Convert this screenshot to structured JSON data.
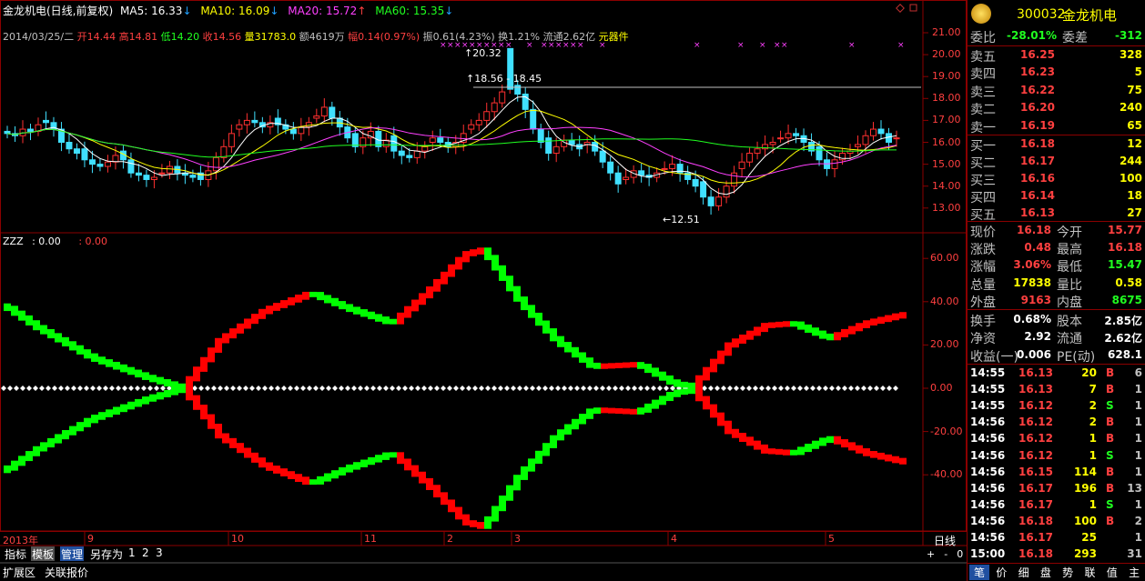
{
  "header": {
    "title": "金龙机电(日线,前复权)",
    "ma5": "MA5: 16.33",
    "ma10": "MA10: 16.09",
    "ma20": "MA20: 15.72",
    "ma60": "MA60: 15.35",
    "date": "2014/03/25/二",
    "open": "开14.44",
    "high": "高14.81",
    "low": "低14.20",
    "close": "收14.56",
    "vol": "量31783.0",
    "amount": "额4619万",
    "change": "幅0.14(0.97%)",
    "amp": "振0.61(4.23%)",
    "turnover": "换1.21%",
    "float": "流通2.62亿",
    "sector": "元器件"
  },
  "price_axis": [
    "21.00",
    "20.00",
    "19.00",
    "18.00",
    "17.00",
    "16.00",
    "15.00",
    "14.00",
    "13.00"
  ],
  "annotations": {
    "high": "20.32",
    "range": "18.56 - 18.45",
    "low": "12.51"
  },
  "indicator": {
    "name": "ZZZ",
    "v1": ": 0.00",
    "v2": ": 0.00",
    "axis": [
      "60.00",
      "40.00",
      "20.00",
      "0.00",
      "-20.00",
      "-40.00"
    ]
  },
  "time_axis": {
    "labels": [
      "2013年",
      "9",
      "10",
      "11",
      "2",
      "3",
      "4",
      "5"
    ],
    "period": "日线"
  },
  "toolbar": {
    "items": [
      "指标",
      "模板",
      "管理",
      "另存为",
      "1",
      "2",
      "3"
    ],
    "zoom": [
      "+",
      "-",
      "0"
    ]
  },
  "bottom_tabs": [
    "扩展区",
    "关联报价"
  ],
  "quote": {
    "code": "300032",
    "name": "金龙机电",
    "weibi_label": "委比",
    "weibi": "-28.01%",
    "weicha_label": "委差",
    "weicha": "-312",
    "asks": [
      {
        "label": "卖五",
        "price": "16.25",
        "vol": "328"
      },
      {
        "label": "卖四",
        "price": "16.23",
        "vol": "5"
      },
      {
        "label": "卖三",
        "price": "16.22",
        "vol": "75"
      },
      {
        "label": "卖二",
        "price": "16.20",
        "vol": "240"
      },
      {
        "label": "卖一",
        "price": "16.19",
        "vol": "65"
      }
    ],
    "bids": [
      {
        "label": "买一",
        "price": "16.18",
        "vol": "12"
      },
      {
        "label": "买二",
        "price": "16.17",
        "vol": "244"
      },
      {
        "label": "买三",
        "price": "16.16",
        "vol": "100"
      },
      {
        "label": "买四",
        "price": "16.14",
        "vol": "18"
      },
      {
        "label": "买五",
        "price": "16.13",
        "vol": "27"
      }
    ],
    "stats1": [
      {
        "l1": "现价",
        "v1": "16.18",
        "l2": "今开",
        "v2": "15.77"
      },
      {
        "l1": "涨跌",
        "v1": "0.48",
        "l2": "最高",
        "v2": "16.18"
      },
      {
        "l1": "涨幅",
        "v1": "3.06%",
        "l2": "最低",
        "v2": "15.47"
      },
      {
        "l1": "总量",
        "v1": "17838",
        "l2": "量比",
        "v2": "0.58"
      },
      {
        "l1": "外盘",
        "v1": "9163",
        "l2": "内盘",
        "v2": "8675"
      }
    ],
    "stats2": [
      {
        "l1": "换手",
        "v1": "0.68%",
        "l2": "股本",
        "v2": "2.85亿"
      },
      {
        "l1": "净资",
        "v1": "2.92",
        "l2": "流通",
        "v2": "2.62亿"
      },
      {
        "l1": "收益(一)",
        "v1": "0.006",
        "l2": "PE(动)",
        "v2": "628.1"
      }
    ],
    "ticks": [
      {
        "t": "14:55",
        "p": "16.13",
        "v": "20",
        "s": "B",
        "n": "6"
      },
      {
        "t": "14:55",
        "p": "16.13",
        "v": "7",
        "s": "B",
        "n": "1"
      },
      {
        "t": "14:55",
        "p": "16.12",
        "v": "2",
        "s": "S",
        "n": "1"
      },
      {
        "t": "14:56",
        "p": "16.12",
        "v": "2",
        "s": "B",
        "n": "1"
      },
      {
        "t": "14:56",
        "p": "16.12",
        "v": "1",
        "s": "B",
        "n": "1"
      },
      {
        "t": "14:56",
        "p": "16.12",
        "v": "1",
        "s": "S",
        "n": "1"
      },
      {
        "t": "14:56",
        "p": "16.15",
        "v": "114",
        "s": "B",
        "n": "1"
      },
      {
        "t": "14:56",
        "p": "16.17",
        "v": "196",
        "s": "B",
        "n": "13"
      },
      {
        "t": "14:56",
        "p": "16.17",
        "v": "1",
        "s": "S",
        "n": "1"
      },
      {
        "t": "14:56",
        "p": "16.18",
        "v": "100",
        "s": "B",
        "n": "2"
      },
      {
        "t": "14:56",
        "p": "16.17",
        "v": "25",
        "s": "",
        "n": "1"
      },
      {
        "t": "15:00",
        "p": "16.18",
        "v": "293",
        "s": "",
        "n": "31"
      }
    ],
    "bottom_tabs": [
      "笔",
      "价",
      "细",
      "盘",
      "势",
      "联",
      "值",
      "主"
    ]
  }
}
